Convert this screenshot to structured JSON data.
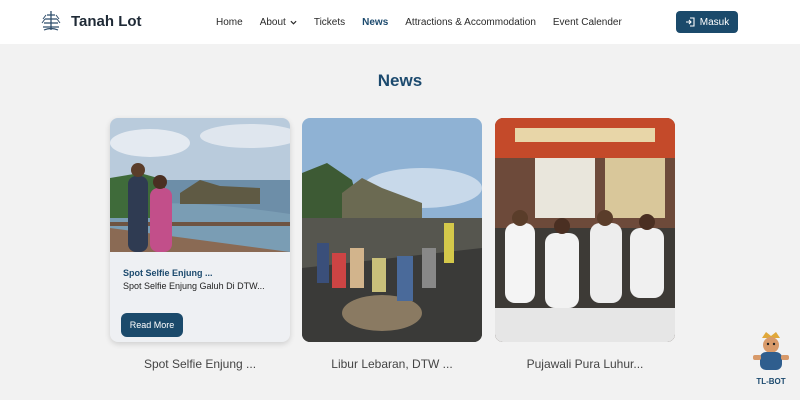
{
  "brand": {
    "name": "Tanah Lot",
    "logo_icon": "temple-logo-icon"
  },
  "nav": {
    "items": [
      {
        "label": "Home"
      },
      {
        "label": "About"
      },
      {
        "label": "Tickets"
      },
      {
        "label": "News"
      },
      {
        "label": "Attractions & Accommodation"
      },
      {
        "label": "Event Calender"
      }
    ],
    "login_label": "Masuk"
  },
  "colors": {
    "accent": "#1b4a6b",
    "title": "#1c4a6e",
    "background": "#f2f2f2"
  },
  "section": {
    "title": "News"
  },
  "cards": [
    {
      "title": "Spot Selfie Enjung ...",
      "desc": "Spot Selfie Enjung Galuh Di DTW...",
      "button": "Read More",
      "caption": "Spot Selfie Enjung ..."
    },
    {
      "caption": "Libur Lebaran, DTW ..."
    },
    {
      "caption": "Pujawali Pura Luhur..."
    }
  ],
  "chatbot": {
    "label": "TL-BOT"
  }
}
